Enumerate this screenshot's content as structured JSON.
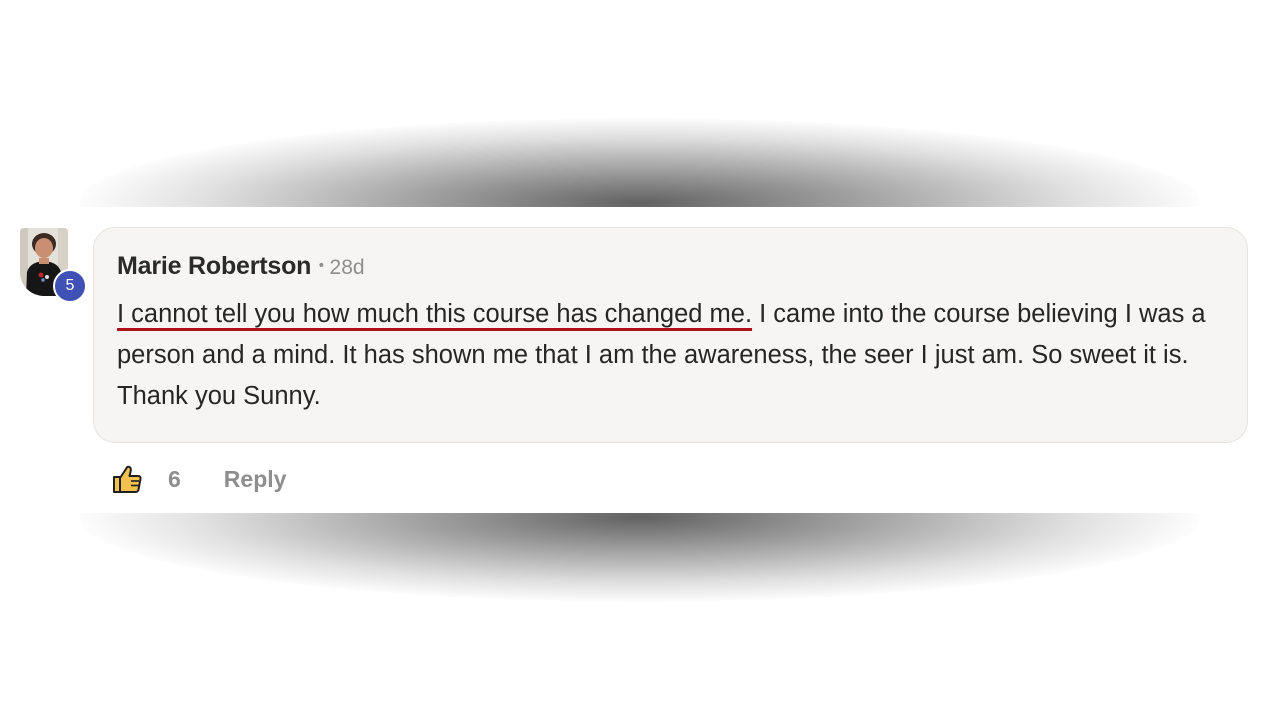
{
  "comment": {
    "author": "Marie Robertson",
    "separator": "•",
    "time_ago": "28d",
    "level": "5",
    "text_highlighted": "I cannot tell you how much this course has changed me.",
    "text_rest": " I came into the course believing I was a person and a mind. It has shown me that I am the awareness, the seer I just am. So sweet it is. Thank you Sunny.",
    "likes": "6",
    "reply_label": "Reply",
    "like_icon": "thumbs-up-icon"
  },
  "colors": {
    "card_background": "#f6f5f4",
    "level_badge": "#3f51b5",
    "underline": "#b0111b",
    "like_icon_fill": "#f2c14e",
    "muted_text": "#8e8e8e"
  }
}
